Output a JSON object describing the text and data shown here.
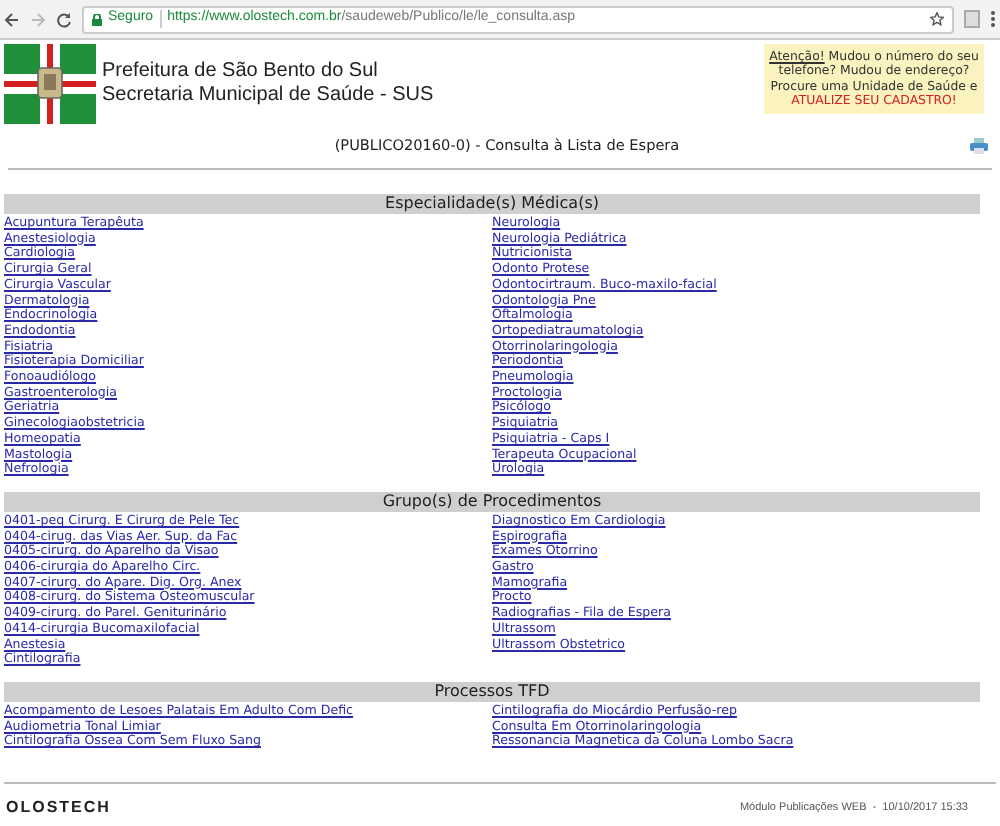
{
  "browser": {
    "security_label": "Seguro",
    "url_host": "https://www.olostech.com.br",
    "url_path": "/saudeweb/Publico/le/le_consulta.asp"
  },
  "header": {
    "title_lines": [
      "Prefeitura de São Bento do Sul",
      "Secretaria Municipal de Saúde - SUS"
    ],
    "notice": {
      "heading": "Atenção!",
      "text": " Mudou o número do seu telefone? Mudou de endereço? Procure uma Unidade de Saúde e",
      "alert": "ATUALIZE SEU CADASTRO!"
    }
  },
  "page_title": "(PUBLICO20160-0) - Consulta à Lista de Espera",
  "sections": [
    {
      "title": "Especialidade(s) Médica(s)",
      "columns": [
        [
          "Acupuntura Terapêuta",
          "Anestesiologia",
          "Cardiologia",
          "Cirurgia Geral",
          "Cirurgia Vascular",
          "Dermatologia",
          "Endocrinologia",
          "Endodontia",
          "Fisiatria",
          "Fisioterapia Domiciliar",
          "Fonoaudiólogo",
          "Gastroenterologia",
          "Geriatria",
          "Ginecologiaobstetricia",
          "Homeopatia",
          "Mastologia",
          "Nefrologia"
        ],
        [
          "Neurologia",
          "Neurologia Pediátrica",
          "Nutricionista",
          "Odonto Protese",
          "Odontocirtraum. Buco-maxilo-facial",
          "Odontologia Pne",
          "Oftalmologia",
          "Ortopediatraumatologia",
          "Otorrinolaringologia",
          "Periodontia",
          "Pneumologia",
          "Proctologia",
          "Psicólogo",
          "Psiquiatria",
          "Psiquiatria - Caps I",
          "Terapeuta Ocupacional",
          "Urologia"
        ]
      ]
    },
    {
      "title": "Grupo(s) de Procedimentos",
      "columns": [
        [
          "0401-peq Cirurg. E Cirurg de Pele Tec",
          "0404-cirug. das Vias Aer. Sup. da Fac",
          "0405-cirurg. do Aparelho da Visao",
          "0406-cirurgia do Aparelho Circ.",
          "0407-cirurg. do Apare. Dig. Org. Anex",
          "0408-cirurg. do Sistema Osteomuscular",
          "0409-cirurg. do Parel. Geniturinário",
          "0414-cirurgia Bucomaxilofacial",
          "Anestesia",
          "Cintilografia"
        ],
        [
          "Diagnostico Em Cardiologia",
          "Espirografia",
          "Exames Otorrino",
          "Gastro",
          "Mamografia",
          "Procto",
          "Radiografias - Fila de Espera",
          "Ultrassom",
          "Ultrassom Obstetrico"
        ]
      ]
    },
    {
      "title": "Processos TFD",
      "columns": [
        [
          "Acompamento de Lesoes Palatais Em Adulto Com Defic",
          "Audiometria Tonal Limiar",
          "Cintilografia Ossea Com Sem Fluxo Sang"
        ],
        [
          "Cintilografia do Miocárdio Perfusão-rep",
          "Consulta Em Otorrinolaringologia",
          "Ressonancia Magnetica da Coluna Lombo Sacra"
        ]
      ]
    }
  ],
  "footer": {
    "logo": "OLOSTECH",
    "info": "Módulo Publicações WEB  -  10/10/2017 15:33"
  }
}
